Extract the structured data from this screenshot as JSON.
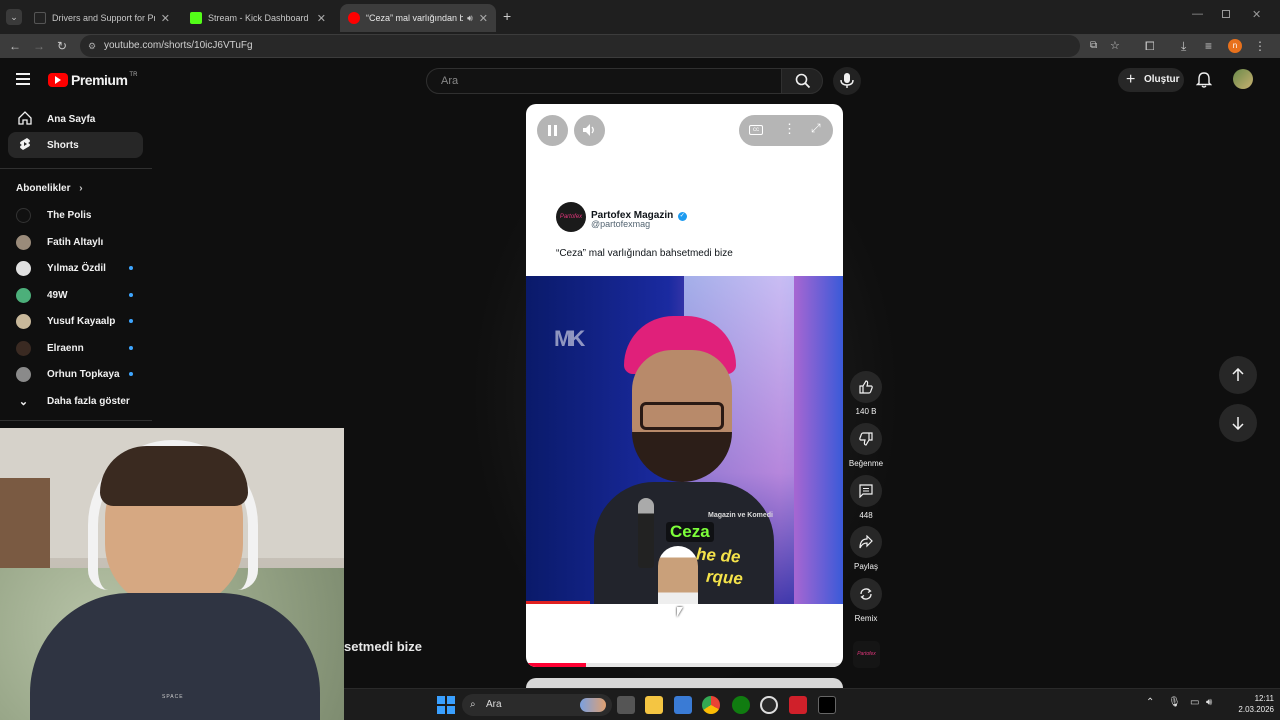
{
  "browser": {
    "tabs": [
      {
        "title": "Drivers and Support for Processo",
        "active": false
      },
      {
        "title": "Stream - Kick Dashboard",
        "active": false
      },
      {
        "title": "“Ceza” mal varlığından bahs",
        "active": true
      }
    ],
    "url": "youtube.com/shorts/10icJ6VTuFg",
    "profile_initial": "n"
  },
  "yt": {
    "logo_text": "Premium",
    "logo_badge": "TR",
    "search_placeholder": "Ara",
    "create_label": "Oluştur",
    "colors": {
      "brand_red": "#ff0000",
      "link_blue": "#3ea6ff",
      "bg": "#0f0f0f"
    }
  },
  "sidebar": {
    "main_items": [
      {
        "label": "Ana Sayfa",
        "icon": "home-icon"
      },
      {
        "label": "Shorts",
        "icon": "shorts-icon"
      }
    ],
    "subscriptions_title": "Abonelikler",
    "subscriptions": [
      {
        "name": "The Polis",
        "live": false,
        "color": "#111111"
      },
      {
        "name": "Fatih Altaylı",
        "live": false,
        "color": "#9a8b7a"
      },
      {
        "name": "Yılmaz Özdil",
        "live": true,
        "color": "#e0e0e0"
      },
      {
        "name": "49W",
        "live": true,
        "color": "#4caf7a"
      },
      {
        "name": "Yusuf Kayaalp",
        "live": true,
        "color": "#c8b89a"
      },
      {
        "name": "Elraenn",
        "live": true,
        "color": "#3a2a22"
      },
      {
        "name": "Orhun Topkaya",
        "live": true,
        "color": "#8a8a8a"
      }
    ],
    "show_more": "Daha fazla göster"
  },
  "short": {
    "tweet_author": "Partofex Magazin",
    "tweet_handle": "@partofexmag",
    "tweet_text": "“Ceza” mal varlığından bahsetmedi bize",
    "avatar_text": "Partofex",
    "video_watermark": "MK",
    "video_caption": "Magazin ve Komedi",
    "video_name_tag": "Ceza",
    "video_overlay_line1": "he de",
    "video_overlay_line2": "rque",
    "progress": 0.19
  },
  "actions": {
    "like_count": "140 B",
    "dislike_label": "Beğenme",
    "comment_count": "448",
    "share_label": "Paylaş",
    "remix_label": "Remix",
    "channel_thumb_text": "Partofex"
  },
  "bg_title_fragment": "setmedi bize",
  "taskbar": {
    "search_label": "Ara",
    "time": "12:11",
    "date": "2.03.2026"
  }
}
